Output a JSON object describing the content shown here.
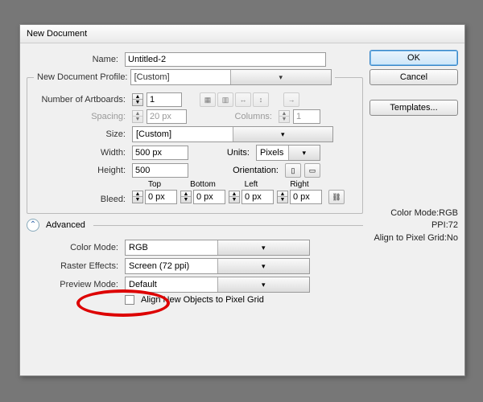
{
  "title": "New Document",
  "name_label": "Name:",
  "name_value": "Untitled-2",
  "profile_legend": "New Document Profile:",
  "profile_value": "[Custom]",
  "artboards_label": "Number of Artboards:",
  "artboards_value": "1",
  "spacing_label": "Spacing:",
  "spacing_value": "20 px",
  "columns_label": "Columns:",
  "columns_value": "1",
  "size_label": "Size:",
  "size_value": "[Custom]",
  "width_label": "Width:",
  "width_value": "500 px",
  "units_label": "Units:",
  "units_value": "Pixels",
  "height_label": "Height:",
  "height_value": "500",
  "orientation_label": "Orientation:",
  "bleed_label": "Bleed:",
  "bleed_top": "Top",
  "bleed_bottom": "Bottom",
  "bleed_left": "Left",
  "bleed_right": "Right",
  "bleed_val": "0 px",
  "advanced_label": "Advanced",
  "colormode_label": "Color Mode:",
  "colormode_value": "RGB",
  "raster_label": "Raster Effects:",
  "raster_value": "Screen (72 ppi)",
  "preview_label": "Preview Mode:",
  "preview_value": "Default",
  "align_label": "Align New Objects to Pixel Grid",
  "btn_ok": "OK",
  "btn_cancel": "Cancel",
  "btn_templates": "Templates...",
  "info1": "Color Mode:RGB",
  "info2": "PPI:72",
  "info3": "Align to Pixel Grid:No"
}
